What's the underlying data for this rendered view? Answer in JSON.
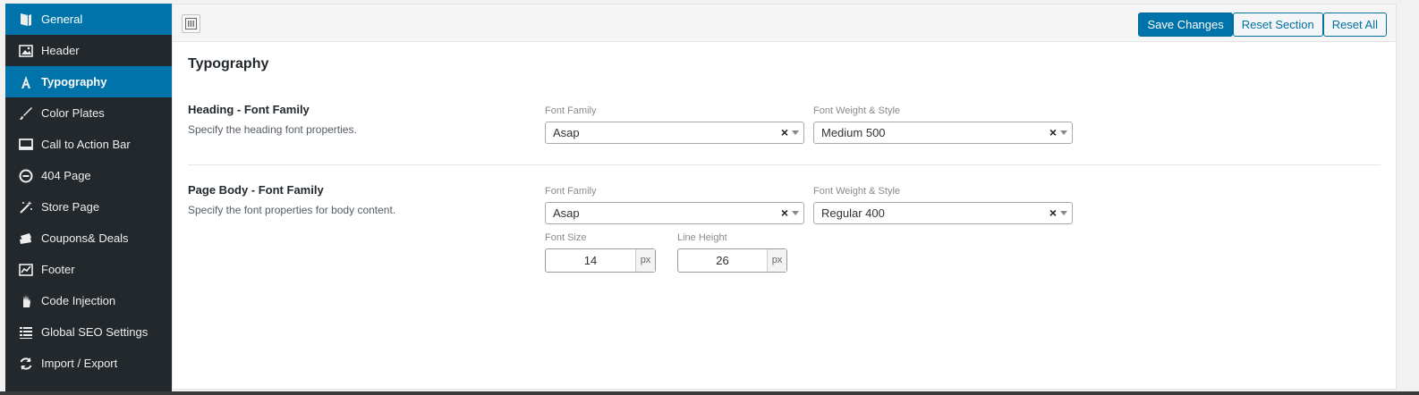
{
  "sidebar": {
    "items": [
      {
        "label": "General",
        "icon": "book-icon",
        "state": "highlight"
      },
      {
        "label": "Header",
        "icon": "image-icon",
        "state": "normal"
      },
      {
        "label": "Typography",
        "icon": "font-icon",
        "state": "active"
      },
      {
        "label": "Color Plates",
        "icon": "brush-icon",
        "state": "normal"
      },
      {
        "label": "Call to Action Bar",
        "icon": "monitor-icon",
        "state": "normal"
      },
      {
        "label": "404 Page",
        "icon": "minus-circle-icon",
        "state": "normal"
      },
      {
        "label": "Store Page",
        "icon": "magic-wand-icon",
        "state": "normal"
      },
      {
        "label": "Coupons& Deals",
        "icon": "tickets-icon",
        "state": "normal"
      },
      {
        "label": "Footer",
        "icon": "chart-icon",
        "state": "normal"
      },
      {
        "label": "Code Injection",
        "icon": "hand-icon",
        "state": "normal"
      },
      {
        "label": "Global SEO Settings",
        "icon": "list-icon",
        "state": "normal"
      },
      {
        "label": "Import / Export",
        "icon": "refresh-icon",
        "state": "normal"
      }
    ]
  },
  "toolbar": {
    "save_label": "Save Changes",
    "reset_section_label": "Reset Section",
    "reset_all_label": "Reset All"
  },
  "main": {
    "title": "Typography",
    "heading": {
      "title": "Heading - Font Family",
      "desc": "Specify the heading font properties.",
      "font_family_label": "Font Family",
      "font_family_value": "Asap",
      "weight_label": "Font Weight & Style",
      "weight_value": "Medium 500"
    },
    "body": {
      "title": "Page Body - Font Family",
      "desc": "Specify the font properties for body content.",
      "font_family_label": "Font Family",
      "font_family_value": "Asap",
      "weight_label": "Font Weight & Style",
      "weight_value": "Regular 400",
      "font_size_label": "Font Size",
      "font_size_value": "14",
      "font_size_unit": "px",
      "line_height_label": "Line Height",
      "line_height_value": "26",
      "line_height_unit": "px"
    }
  },
  "colors": {
    "sidebar_bg": "#23282d",
    "accent": "#0073aa"
  }
}
